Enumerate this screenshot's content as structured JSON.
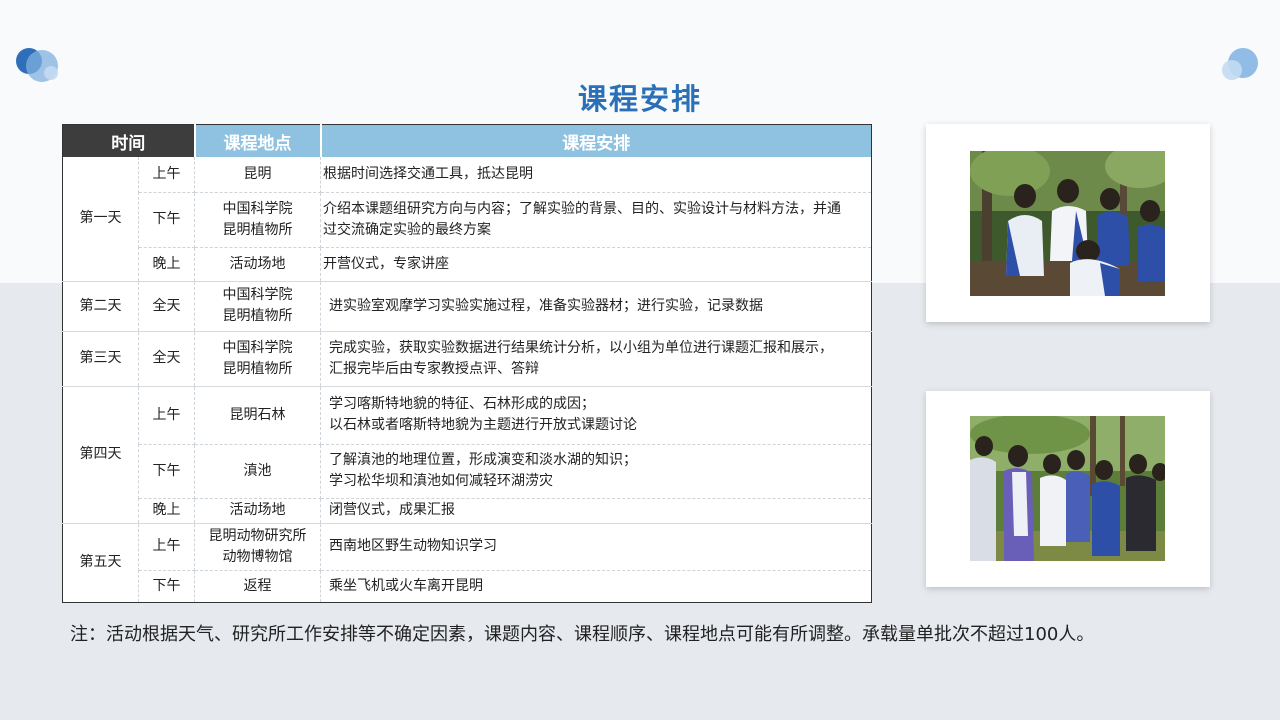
{
  "title": "课程安排",
  "table": {
    "headers": {
      "time": "时间",
      "location": "课程地点",
      "plan": "课程安排"
    },
    "days": {
      "d1": "第一天",
      "d2": "第二天",
      "d3": "第三天",
      "d4": "第四天",
      "d5": "第五天"
    },
    "rows": [
      {
        "slot": "上午",
        "loc": [
          "昆明"
        ],
        "plan": [
          "根据时间选择交通工具，抵达昆明"
        ]
      },
      {
        "slot": "下午",
        "loc": [
          "中国科学院",
          "昆明植物所"
        ],
        "plan": [
          "介绍本课题组研究方向与内容；了解实验的背景、目的、实验设计与材料方法，并通",
          "过交流确定实验的最终方案"
        ]
      },
      {
        "slot": "晚上",
        "loc": [
          "活动场地"
        ],
        "plan": [
          "开营仪式，专家讲座"
        ]
      },
      {
        "slot": "全天",
        "loc": [
          "中国科学院",
          "昆明植物所"
        ],
        "plan": [
          "进实验室观摩学习实验实施过程，准备实验器材；进行实验，记录数据"
        ]
      },
      {
        "slot": "全天",
        "loc": [
          "中国科学院",
          "昆明植物所"
        ],
        "plan": [
          "完成实验，获取实验数据进行结果统计分析，以小组为单位进行课题汇报和展示，",
          "汇报完毕后由专家教授点评、答辩"
        ]
      },
      {
        "slot": "上午",
        "loc": [
          "昆明石林"
        ],
        "plan": [
          "学习喀斯特地貌的特征、石林形成的成因；",
          "以石林或者喀斯特地貌为主题进行开放式课题讨论"
        ]
      },
      {
        "slot": "下午",
        "loc": [
          "滇池"
        ],
        "plan": [
          "了解滇池的地理位置，形成演变和淡水湖的知识；",
          "学习松华坝和滇池如何减轻环湖涝灾"
        ]
      },
      {
        "slot": "晚上",
        "loc": [
          "活动场地"
        ],
        "plan": [
          "闭营仪式，成果汇报"
        ]
      },
      {
        "slot": "上午",
        "loc": [
          "昆明动物研究所",
          "动物博物馆"
        ],
        "plan": [
          "西南地区野生动物知识学习"
        ]
      },
      {
        "slot": "下午",
        "loc": [
          "返程"
        ],
        "plan": [
          "乘坐飞机或火车离开昆明"
        ]
      }
    ]
  },
  "note": "注：活动根据天气、研究所工作安排等不确定因素，课题内容、课程顺序、课程地点可能有所调整。承载量单批次不超过100人。",
  "colors": {
    "title": "#2b70b6",
    "header_dark": "#3d3d3d",
    "header_light": "#8fc1e0"
  }
}
